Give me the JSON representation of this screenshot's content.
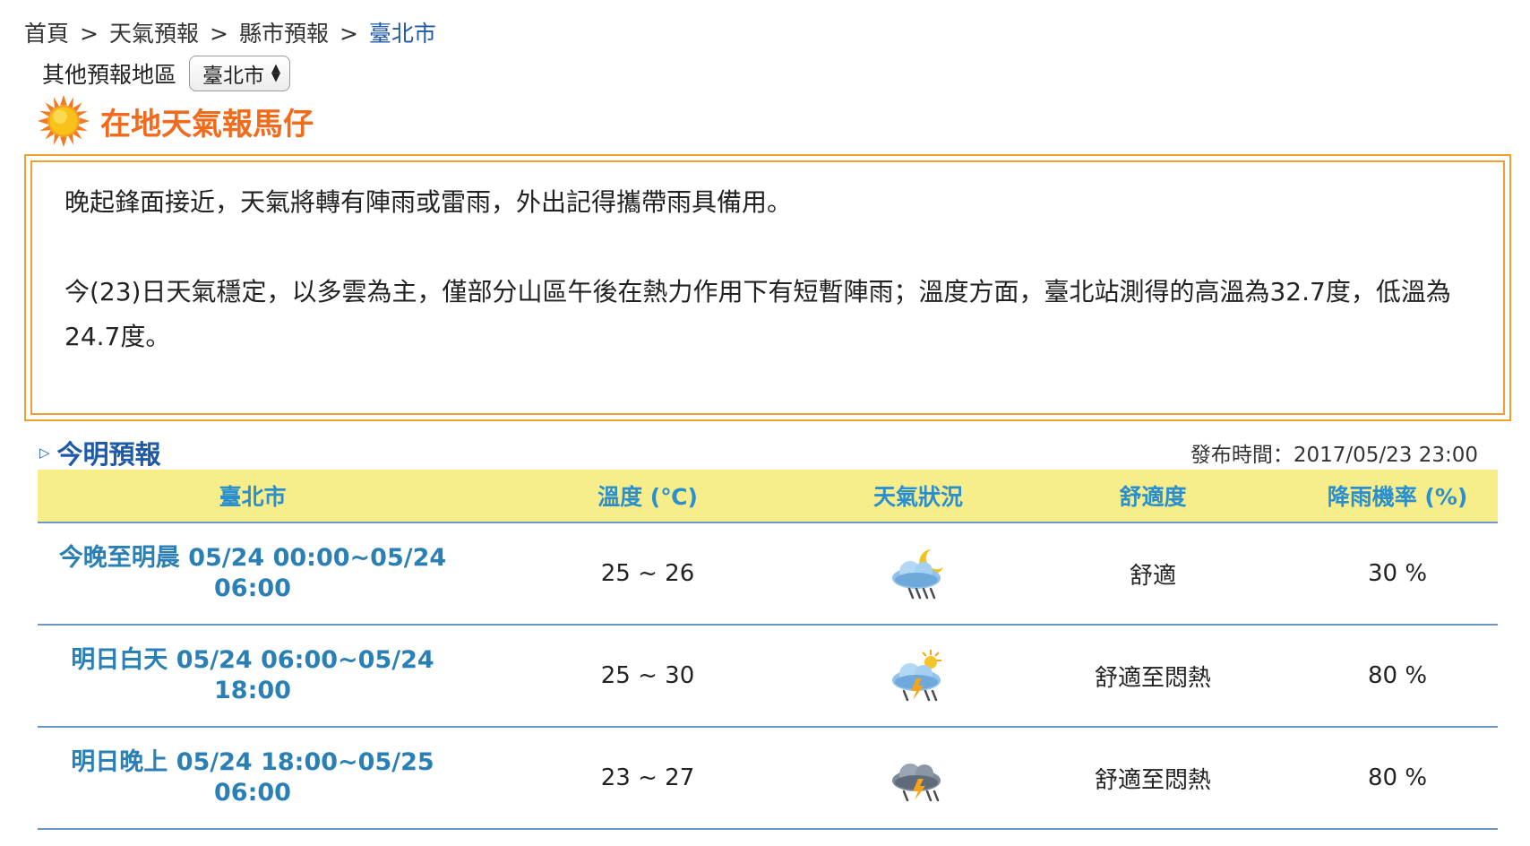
{
  "breadcrumb": {
    "items": [
      "首頁",
      "天氣預報",
      "縣市預報"
    ],
    "current": "臺北市",
    "separator": ">"
  },
  "region_selector": {
    "label": "其他預報地區",
    "selected": "臺北市"
  },
  "title": {
    "text": "在地天氣報馬仔",
    "icon": "sun-icon"
  },
  "summary": {
    "paragraphs": [
      "晚起鋒面接近，天氣將轉有陣雨或雷雨，外出記得攜帶雨具備用。",
      "今(23)日天氣穩定，以多雲為主，僅部分山區午後在熱力作用下有短暫陣雨；溫度方面，臺北站測得的高溫為32.7度，低溫為24.7度。"
    ]
  },
  "forecast": {
    "section_title": "今明預報",
    "publish_time": "發布時間：2017/05/23 23:00",
    "headers": [
      "臺北市",
      "溫度 (℃)",
      "天氣狀況",
      "舒適度",
      "降雨機率 (%)"
    ],
    "rows": [
      {
        "period_line1": "今晚至明晨 05/24 00:00~05/24",
        "period_line2": "06:00",
        "temperature": "25 ~ 26",
        "weather_icon": "cloudy-night-rain-icon",
        "comfort": "舒適",
        "rain_chance": "30 %"
      },
      {
        "period_line1": "明日白天 05/24 06:00~05/24",
        "period_line2": "18:00",
        "temperature": "25 ~ 30",
        "weather_icon": "sunny-thunderstorm-icon",
        "comfort": "舒適至悶熱",
        "rain_chance": "80 %"
      },
      {
        "period_line1": "明日晚上 05/24 18:00~05/25",
        "period_line2": "06:00",
        "temperature": "23 ~ 27",
        "weather_icon": "thunderstorm-icon",
        "comfort": "舒適至悶熱",
        "rain_chance": "80 %"
      }
    ]
  }
}
